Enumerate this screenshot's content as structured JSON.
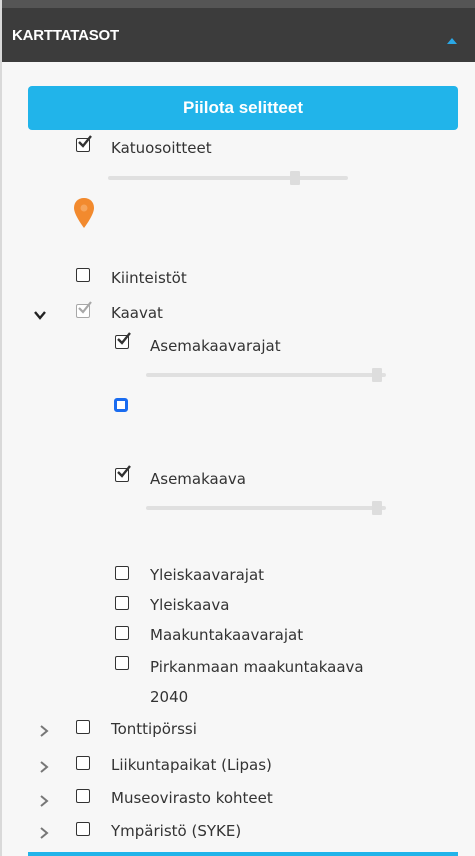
{
  "panel": {
    "title": "KARTTATASOT",
    "hide_legends_label": "Piilota selitteet"
  },
  "layers": {
    "katuosoitteet": "Katuosoitteet",
    "kiinteistot": "Kiinteistöt",
    "kaavat": "Kaavat",
    "asemakaavarajat": "Asemakaavarajat",
    "asemakaava": "Asemakaava",
    "yleiskaavarajat": "Yleiskaavarajat",
    "yleiskaava": "Yleiskaava",
    "maakuntakaavarajat": "Maakuntakaavarajat",
    "pirkanmaan_line1": "Pirkanmaan maakuntakaava",
    "pirkanmaan_line2": "2040",
    "tonttiporssi": "Tonttipörssi",
    "liikuntapaikat": "Liikuntapaikat (Lipas)",
    "museovirasto": "Museovirasto kohteet",
    "ymparisto": "Ympäristö (SYKE)"
  },
  "colors": {
    "header_bg": "#3c3c3c",
    "accent": "#21b4ea",
    "marker": "#f28a2e",
    "legend_square": "#1a6cf0"
  }
}
